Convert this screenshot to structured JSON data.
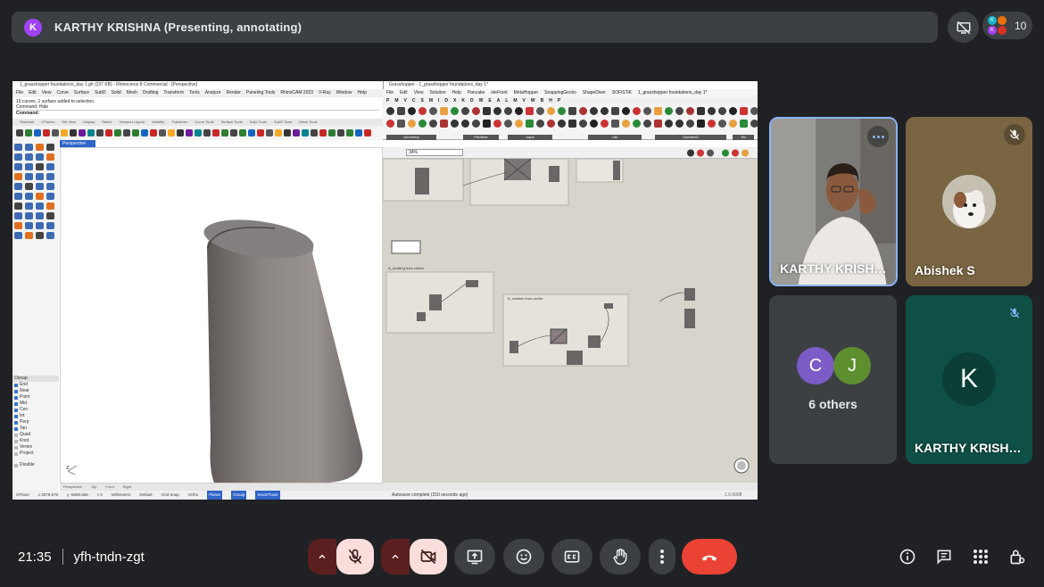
{
  "meeting": {
    "presenter_initial": "K",
    "presenter_banner": "KARTHY KRISHNA (Presenting, annotating)",
    "participant_count": "10",
    "time": "21:35",
    "meeting_code": "yfh-tndn-zgt"
  },
  "participants": {
    "tile1_name": "KARTHY KRISH…",
    "tile2_name": "Abishek S",
    "others_label": "6 others",
    "others_avatar1": "C",
    "others_avatar2": "J",
    "tile4_initial": "K",
    "tile4_name": "KARTHY KRISH…"
  },
  "rhino": {
    "title": "1_grasshopper foundations_day 1.gh (237 KB) - Rhinoceros 8 Commercial - [Perspective]",
    "menus": [
      "File",
      "Edit",
      "View",
      "Curve",
      "Surface",
      "SubD",
      "Solid",
      "Mesh",
      "Drafting",
      "Transform",
      "Tools",
      "Analyze",
      "Render",
      "Paneling Tools",
      "RhinoCAM 2023",
      "V-Ray",
      "Window",
      "Help"
    ],
    "cmd_line1": "10 curves, 1 surface added to selection.",
    "cmd_line2": "Command: Hide",
    "cmd_line3": "Command:",
    "toolbar_tabs": [
      "Standard",
      "CPlanes",
      "Set View",
      "Display",
      "Select",
      "Viewport Layout",
      "Visibility",
      "Transform",
      "Curve Tools",
      "Surface Tools",
      "Solid Tools",
      "SubD Tools",
      "Mesh Tools"
    ],
    "viewport_label": "Perspective",
    "osnap_title": "Osnap",
    "osnap_items": [
      "End",
      "Near",
      "Point",
      "Mid",
      "Cen",
      "Int",
      "Perp",
      "Tan",
      "Quad",
      "Knot",
      "Vertex",
      "Project"
    ],
    "osnap_disable": "Disable",
    "viewport_tabs": [
      "Perspective",
      "Top",
      "Front",
      "Right"
    ],
    "status": [
      "CPlane",
      "x 2579.879",
      "y -5690.868",
      "z 0",
      "Millimeters",
      "Default",
      "Grid Snap",
      "Ortho",
      "Planar",
      "Osnap",
      "SmartTrack"
    ]
  },
  "grasshopper": {
    "title": "Grasshopper - 1_grasshopper foundations_day 1*",
    "menus": [
      "File",
      "Edit",
      "View",
      "Solution",
      "Help",
      "Pancake",
      "eleFront",
      "MetaHopper",
      "SnappingGecko",
      "ShapeDiver",
      "SOFiSTiK",
      "1_grasshopper foundations_day 1*"
    ],
    "tabs": [
      "P",
      "M",
      "V",
      "C",
      "S",
      "M",
      "I",
      "D",
      "X",
      "K",
      "D",
      "W",
      "E",
      "A",
      "L",
      "M",
      "V",
      "W",
      "B",
      "H",
      "P"
    ],
    "groups": [
      "Geometry",
      "Primitive",
      "Input",
      "Util",
      "Openbet2",
      "Tex"
    ],
    "zoom": "34%",
    "group_labels": [
      "A_locating from center",
      "B_rotation from center"
    ],
    "status": "Autosave complete (210 seconds ago)",
    "version": "1.0.0008"
  },
  "colors": {
    "accent_blue": "#8ab4f8",
    "hangup_red": "#ea4335",
    "muted_control": "#f9dedc",
    "presenter_avatar": "#a142f4",
    "tile_green": "#0f5046"
  },
  "icons": [
    "mic-off-icon",
    "camera-off-icon",
    "present-icon",
    "emoji-icon",
    "captions-icon",
    "raise-hand-icon",
    "more-options-icon",
    "hangup-icon",
    "info-icon",
    "chat-icon",
    "activities-icon",
    "host-controls-icon",
    "screen-off-icon"
  ]
}
